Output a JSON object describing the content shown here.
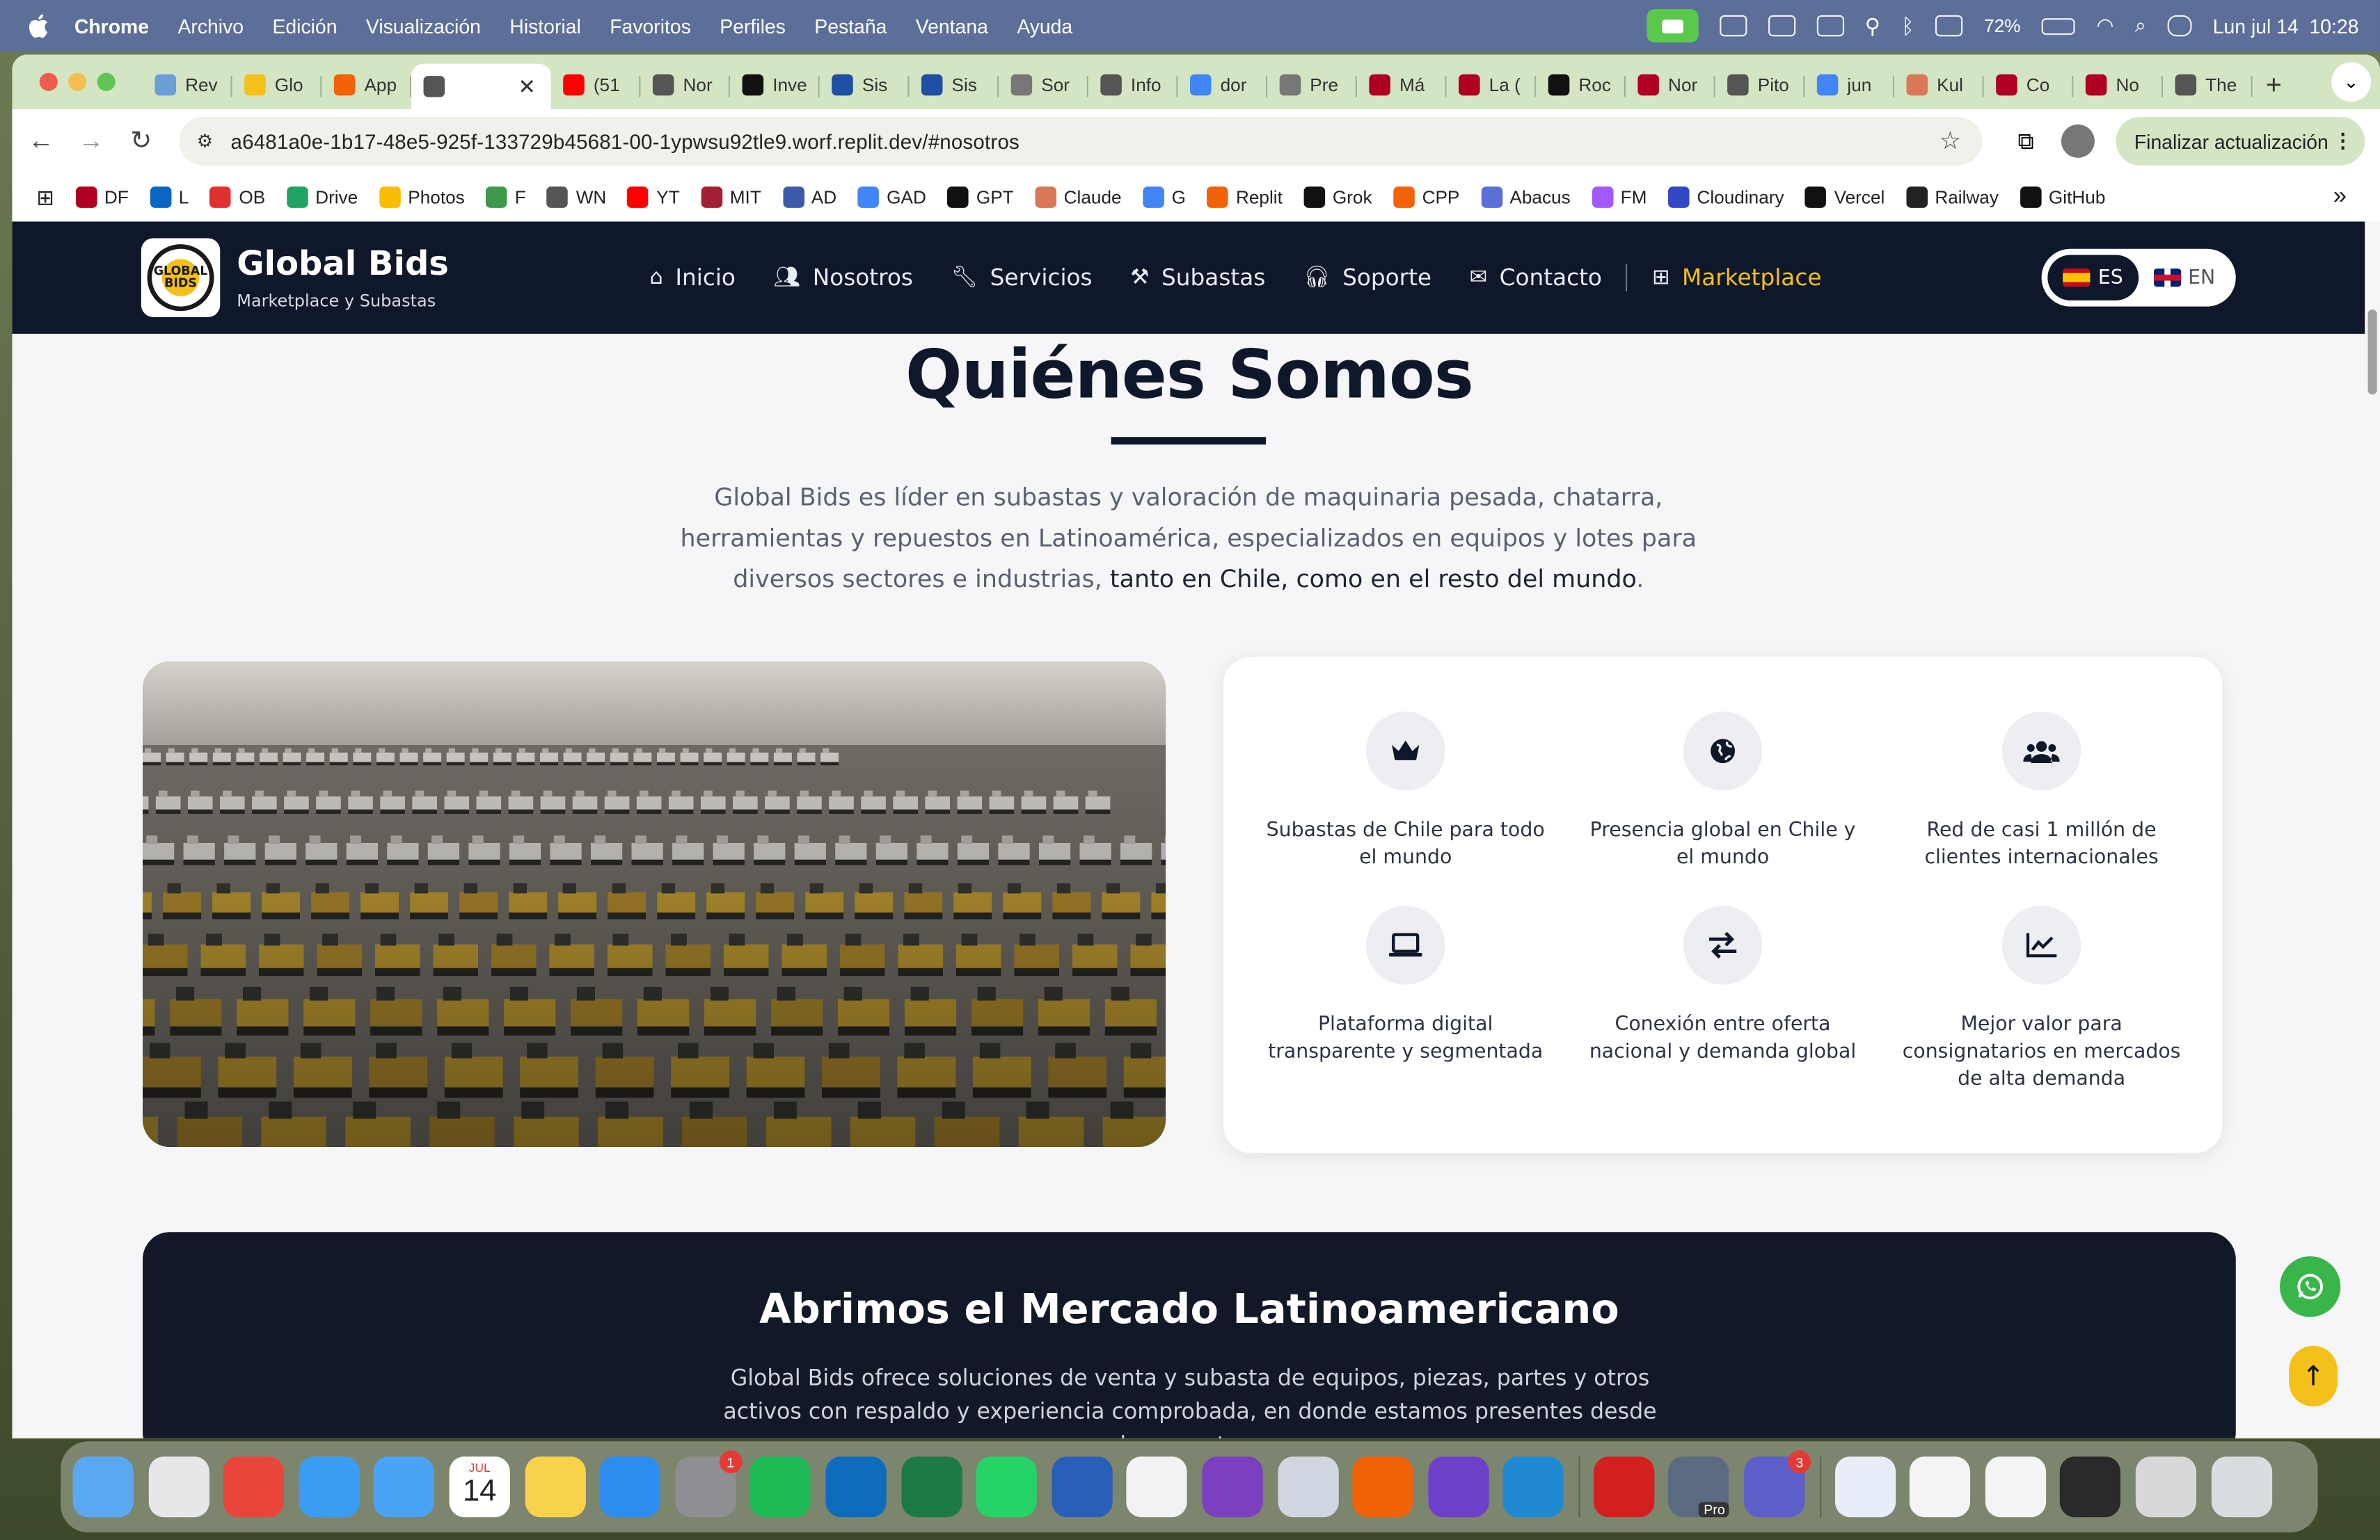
{
  "menubar": {
    "app": "Chrome",
    "items": [
      "Archivo",
      "Edición",
      "Visualización",
      "Historial",
      "Favoritos",
      "Perfiles",
      "Pestaña",
      "Ventana",
      "Ayuda"
    ],
    "battery": "72%",
    "datetime": "Lun jul 14  10:28"
  },
  "tabs": [
    {
      "label": "Rev",
      "color": "#6a9fd8"
    },
    {
      "label": "Glo",
      "color": "#f4c01a"
    },
    {
      "label": "App",
      "color": "#f26207"
    },
    {
      "label": "",
      "color": "#555555",
      "active": true
    },
    {
      "label": "(51",
      "color": "#ff0000"
    },
    {
      "label": "Nor",
      "color": "#555555"
    },
    {
      "label": "Inve",
      "color": "#111111"
    },
    {
      "label": "Sis",
      "color": "#1e4fa3"
    },
    {
      "label": "Sis",
      "color": "#1e4fa3"
    },
    {
      "label": "Sor",
      "color": "#777777"
    },
    {
      "label": "Info",
      "color": "#555555"
    },
    {
      "label": "dor",
      "color": "#4285f4"
    },
    {
      "label": "Pre",
      "color": "#777777"
    },
    {
      "label": "Má",
      "color": "#b00020"
    },
    {
      "label": "La (",
      "color": "#b00020"
    },
    {
      "label": "Roc",
      "color": "#111111"
    },
    {
      "label": "Nor",
      "color": "#b00020"
    },
    {
      "label": "Pito",
      "color": "#555555"
    },
    {
      "label": "jun",
      "color": "#4285f4"
    },
    {
      "label": "Kul",
      "color": "#d97757"
    },
    {
      "label": "Co",
      "color": "#b00020"
    },
    {
      "label": "No",
      "color": "#b00020"
    },
    {
      "label": "The",
      "color": "#555555"
    }
  ],
  "omnibox": {
    "url": "a6481a0e-1b17-48e5-925f-133729b45681-00-1ypwsu92tle9.worf.replit.dev/#nosotros"
  },
  "toolbar": {
    "update_label": "Finalizar actualización"
  },
  "bookmarks": [
    {
      "label": "DF",
      "color": "#b00020"
    },
    {
      "label": "L",
      "color": "#0a66c2"
    },
    {
      "label": "OB",
      "color": "#e03131"
    },
    {
      "label": "Drive",
      "color": "#1fa463"
    },
    {
      "label": "Photos",
      "color": "#fbbc04"
    },
    {
      "label": "F",
      "color": "#3c9a4a"
    },
    {
      "label": "WN",
      "color": "#555555"
    },
    {
      "label": "YT",
      "color": "#ff0000"
    },
    {
      "label": "MIT",
      "color": "#a31f34"
    },
    {
      "label": "AD",
      "color": "#3b5ba9"
    },
    {
      "label": "GAD",
      "color": "#4285f4"
    },
    {
      "label": "GPT",
      "color": "#111111"
    },
    {
      "label": "Claude",
      "color": "#d97757"
    },
    {
      "label": "G",
      "color": "#4285f4"
    },
    {
      "label": "Replit",
      "color": "#f26207"
    },
    {
      "label": "Grok",
      "color": "#111111"
    },
    {
      "label": "CPP",
      "color": "#f26207"
    },
    {
      "label": "Abacus",
      "color": "#5b6fd6"
    },
    {
      "label": "FM",
      "color": "#a259ff"
    },
    {
      "label": "Cloudinary",
      "color": "#3448c5"
    },
    {
      "label": "Vercel",
      "color": "#111111"
    },
    {
      "label": "Railway",
      "color": "#222222"
    },
    {
      "label": "GitHub",
      "color": "#111111"
    }
  ],
  "site": {
    "brand_title": "Global Bids",
    "brand_sub": "Marketplace y Subastas",
    "logo_text": "GLOBAL BIDS",
    "nav": [
      "Inicio",
      "Nosotros",
      "Servicios",
      "Subastas",
      "Soporte",
      "Contacto"
    ],
    "nav_marketplace": "Marketplace",
    "lang_es": "ES",
    "lang_en": "EN",
    "colors": {
      "navy": "#0f172a",
      "accent": "#f4c01a",
      "whatsapp": "#3ab54a"
    }
  },
  "about": {
    "title": "Quiénes Somos",
    "intro_plain": "Global Bids es líder en subastas y valoración de maquinaria pesada, chatarra, herramientas y repuestos en Latinoamérica, especializados en equipos y lotes para diversos sectores e industrias, ",
    "intro_strong": "tanto en Chile, como en el resto del mundo",
    "intro_end": ".",
    "features": [
      {
        "icon": "crown-icon",
        "text": "Subastas de Chile para todo el mundo"
      },
      {
        "icon": "globe-icon",
        "text": "Presencia global en Chile y el mundo"
      },
      {
        "icon": "users-icon",
        "text": "Red de casi 1 millón de clientes internacionales"
      },
      {
        "icon": "laptop-icon",
        "text": "Plataforma digital transparente y segmentada"
      },
      {
        "icon": "exchange-icon",
        "text": "Conexión entre oferta nacional y demanda global"
      },
      {
        "icon": "chart-line-icon",
        "text": "Mejor valor para consignatarios en mercados de alta demanda"
      }
    ]
  },
  "market": {
    "title": "Abrimos el Mercado Latinoamericano",
    "text": "Global Bids ofrece soluciones de venta y subasta de equipos, piezas, partes y otros activos con respaldo y experiencia comprobada, en donde estamos presentes desde el momento en"
  },
  "dock": {
    "calendar_month": "JUL",
    "calendar_day": "14",
    "badges": {
      "settings": "1",
      "teams": "3"
    },
    "pro_label": "Pro"
  }
}
